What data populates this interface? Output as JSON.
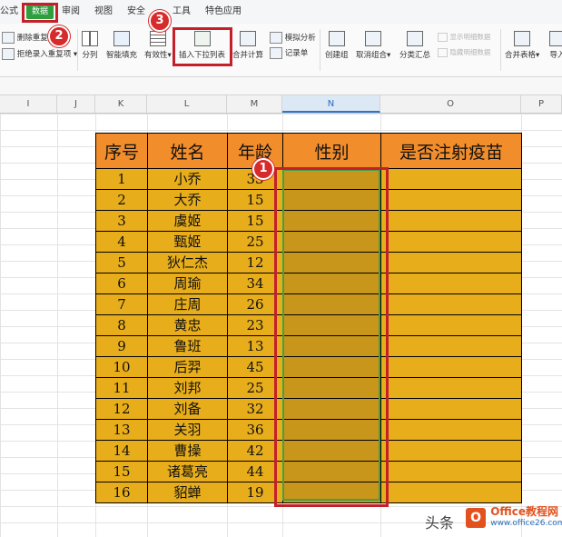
{
  "menu": {
    "formula": "公式",
    "data": "数据",
    "review": "审阅",
    "view": "视图",
    "security": "安全",
    "tools": "工具",
    "special": "特色应用"
  },
  "ribbon": {
    "delete_duplicates": "删除重复",
    "reject_duplicates": "拒绝录入重复项",
    "split_column": "分列",
    "smart_fill": "智能填充",
    "validity": "有效性",
    "insert_dropdown": "插入下拉列表",
    "merge_calc": "合并计算",
    "simulation": "模拟分析",
    "record_sheet": "记录单",
    "create_group": "创建组",
    "ungroup": "取消组合",
    "subtotal": "分类汇总",
    "show_detail": "显示明细数据",
    "hide_detail": "隐藏明细数据",
    "merge_tables": "合并表格",
    "import": "导入"
  },
  "columns": [
    "I",
    "J",
    "K",
    "L",
    "M",
    "N",
    "O",
    "P"
  ],
  "selected_column": "N",
  "table": {
    "headers": [
      "序号",
      "姓名",
      "年龄",
      "性别",
      "是否注射疫苗"
    ],
    "rows": [
      [
        "1",
        "小乔",
        "33"
      ],
      [
        "2",
        "大乔",
        "15"
      ],
      [
        "3",
        "虞姬",
        "15"
      ],
      [
        "4",
        "甄姬",
        "25"
      ],
      [
        "5",
        "狄仁杰",
        "12"
      ],
      [
        "6",
        "周瑜",
        "34"
      ],
      [
        "7",
        "庄周",
        "26"
      ],
      [
        "8",
        "黄忠",
        "23"
      ],
      [
        "9",
        "鲁班",
        "13"
      ],
      [
        "10",
        "后羿",
        "45"
      ],
      [
        "11",
        "刘邦",
        "25"
      ],
      [
        "12",
        "刘备",
        "32"
      ],
      [
        "13",
        "关羽",
        "36"
      ],
      [
        "14",
        "曹操",
        "42"
      ],
      [
        "15",
        "诸葛亮",
        "44"
      ],
      [
        "16",
        "貂蝉",
        "19"
      ]
    ]
  },
  "annotations": {
    "step1": "1",
    "step2": "2",
    "step3": "3",
    "color": "#c4202a"
  },
  "watermark": {
    "toutiao": "头条",
    "site_name": "Office教程网",
    "site_url": "www.office26.com"
  }
}
